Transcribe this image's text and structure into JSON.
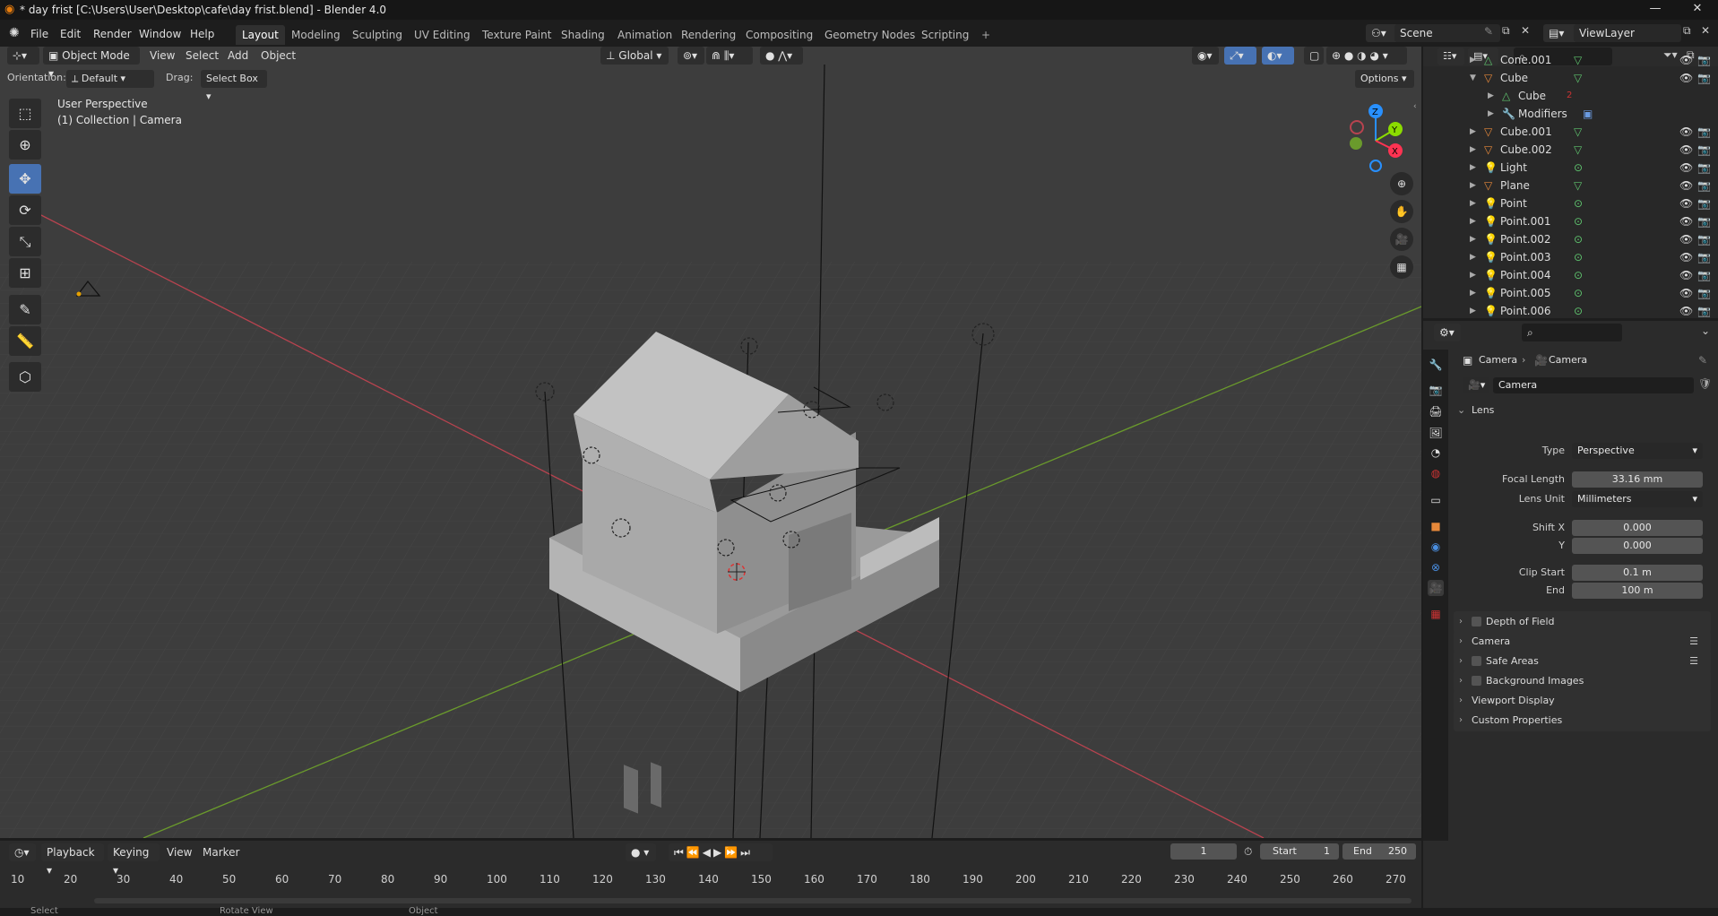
{
  "window": {
    "title": "* day frist [C:\\Users\\User\\Desktop\\cafe\\day frist.blend] - Blender 4.0",
    "minimize": "—",
    "maximize": "❐",
    "close": "✕"
  },
  "menubar": {
    "items": [
      "File",
      "Edit",
      "Render",
      "Window",
      "Help"
    ]
  },
  "workspaces": {
    "tabs": [
      "Layout",
      "Modeling",
      "Sculpting",
      "UV Editing",
      "Texture Paint",
      "Shading",
      "Animation",
      "Rendering",
      "Compositing",
      "Geometry Nodes",
      "Scripting"
    ],
    "active": "Layout",
    "add": "+"
  },
  "scene": {
    "name": "Scene",
    "view_layer": "ViewLayer"
  },
  "viewport_header": {
    "mode": "Object Mode",
    "menus": [
      "View",
      "Select",
      "Add",
      "Object"
    ],
    "transform_orientation": "Global",
    "orientation_label": "Orientation:",
    "orientation_value": "Default",
    "drag_label": "Drag:",
    "drag_value": "Select Box",
    "options": "Options"
  },
  "viewport": {
    "view_name": "User Perspective",
    "collection_info": "(1) Collection | Camera",
    "gizmo_axes": {
      "x": "X",
      "y": "Y",
      "z": "Z"
    }
  },
  "outliner": {
    "rows": [
      {
        "name": "Cone.001",
        "indent": 0,
        "icon": "mesh"
      },
      {
        "name": "Cube",
        "indent": 0,
        "icon": "object",
        "expanded": true
      },
      {
        "name": "Cube",
        "indent": 1,
        "icon": "mesh-data",
        "badge": "2"
      },
      {
        "name": "Modifiers",
        "indent": 1,
        "icon": "wrench"
      },
      {
        "name": "Cube.001",
        "indent": 0,
        "icon": "object"
      },
      {
        "name": "Cube.002",
        "indent": 0,
        "icon": "object"
      },
      {
        "name": "Light",
        "indent": 0,
        "icon": "light"
      },
      {
        "name": "Plane",
        "indent": 0,
        "icon": "object"
      },
      {
        "name": "Point",
        "indent": 0,
        "icon": "light"
      },
      {
        "name": "Point.001",
        "indent": 0,
        "icon": "light"
      },
      {
        "name": "Point.002",
        "indent": 0,
        "icon": "light"
      },
      {
        "name": "Point.003",
        "indent": 0,
        "icon": "light"
      },
      {
        "name": "Point.004",
        "indent": 0,
        "icon": "light"
      },
      {
        "name": "Point.005",
        "indent": 0,
        "icon": "light"
      },
      {
        "name": "Point.006",
        "indent": 0,
        "icon": "light"
      }
    ]
  },
  "properties": {
    "breadcrumb": [
      "Camera",
      "Camera"
    ],
    "datablock": "Camera",
    "lens_panel": "Lens",
    "type_label": "Type",
    "type_value": "Perspective",
    "focal_label": "Focal Length",
    "focal_value": "33.16 mm",
    "lens_unit_label": "Lens Unit",
    "lens_unit_value": "Millimeters",
    "shiftx_label": "Shift X",
    "shiftx_value": "0.000",
    "shifty_label": "Y",
    "shifty_value": "0.000",
    "clip_start_label": "Clip Start",
    "clip_start_value": "0.1 m",
    "clip_end_label": "End",
    "clip_end_value": "100 m",
    "panels": [
      "Depth of Field",
      "Camera",
      "Safe Areas",
      "Background Images",
      "Viewport Display",
      "Custom Properties"
    ]
  },
  "timeline": {
    "menus": [
      "Playback",
      "Keying",
      "View",
      "Marker"
    ],
    "current_frame": "1",
    "start_label": "Start",
    "start_value": "1",
    "end_label": "End",
    "end_value": "250",
    "ticks": [
      "10",
      "20",
      "30",
      "40",
      "50",
      "60",
      "70",
      "80",
      "90",
      "100",
      "110",
      "120",
      "130",
      "140",
      "150",
      "160",
      "170",
      "180",
      "190",
      "200",
      "210",
      "220",
      "230",
      "240",
      "250",
      "260",
      "270"
    ]
  },
  "statusbar": {
    "items": [
      "Select",
      "Rotate View",
      "Object"
    ]
  },
  "colors": {
    "accent": "#4772b3",
    "x_axis": "#ff3352",
    "y_axis": "#8bdc00",
    "z_axis": "#2890ff",
    "object_orange": "#e6883a",
    "mesh_green": "#5fc46e"
  }
}
